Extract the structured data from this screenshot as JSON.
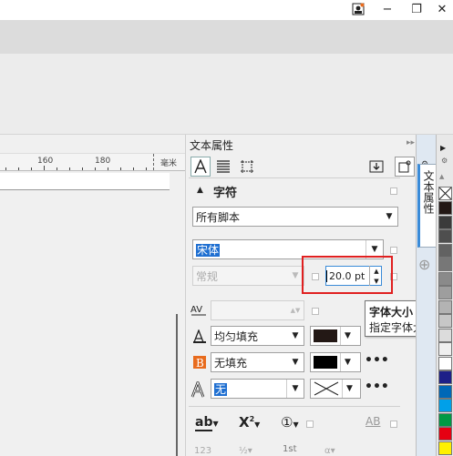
{
  "window": {
    "minimize_glyph": "−",
    "restore_glyph": "❐",
    "close_glyph": "✕"
  },
  "ruler": {
    "labels": [
      "160",
      "180"
    ],
    "unit": "毫米"
  },
  "panel": {
    "title": "文本属性",
    "collapse_glyph": "▸▸",
    "close_glyph": "✕",
    "tab_label": "文本属性"
  },
  "character": {
    "header": "字符",
    "script": "所有脚本",
    "font": "宋体",
    "style": "常规",
    "size": "20.0 pt",
    "underline_fill": "均匀填充",
    "background_fill": "无填充",
    "outline": "无",
    "colors": {
      "text_fill": "#231815",
      "background": "#000000",
      "accent": "#1f6fd1",
      "highlight": "#e02020"
    }
  },
  "tooltip": {
    "title": "字体大小",
    "body": "指定字体大小"
  },
  "bottom_icons": {
    "subscript": "ab",
    "superscript": "X",
    "superscript_mark": "2",
    "circled": "①",
    "caps": "AB",
    "ordinal": "1st"
  },
  "palette": [
    "#ffffff",
    "#231815",
    "#3b3b3b",
    "#4e4e4e",
    "#626262",
    "#777777",
    "#8a8a8a",
    "#9e9e9e",
    "#b3b3b3",
    "#c7c7c7",
    "#dcdcdc",
    "#f0f0f0",
    "#ffffff",
    "#1d2088",
    "#0068b7",
    "#00a0e9",
    "#009944",
    "#e60012",
    "#fff100"
  ]
}
